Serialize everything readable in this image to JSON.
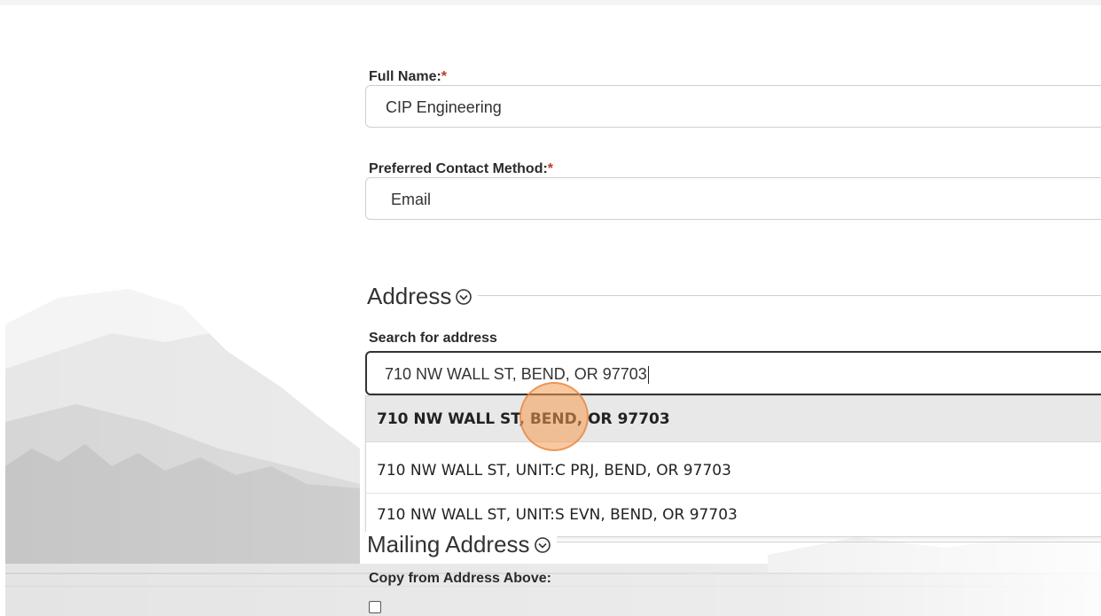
{
  "form": {
    "full_name": {
      "label": "Full Name:",
      "required_mark": "*",
      "value": "CIP Engineering"
    },
    "contact_method": {
      "label": "Preferred Contact Method:",
      "required_mark": "*",
      "value": "Email"
    },
    "address_section": {
      "title": "Address",
      "toggle_icon": "chevron-down-circle-icon"
    },
    "address_search": {
      "label": "Search for address",
      "value": "710 NW WALL ST, BEND, OR 97703",
      "suggestions": [
        "710 NW WALL ST, BEND, OR 97703",
        "710 NW WALL ST, UNIT:C PRJ, BEND, OR 97703",
        "710 NW WALL ST, UNIT:S EVN, BEND, OR 97703"
      ]
    },
    "mailing_section": {
      "title": "Mailing Address",
      "toggle_icon": "chevron-down-circle-icon"
    },
    "copy_from_address": {
      "label": "Copy from Address Above:",
      "checked": false
    }
  },
  "colors": {
    "required": "#c0392b",
    "highlight": "#e8e8e8",
    "cursor": "#f49a50"
  }
}
